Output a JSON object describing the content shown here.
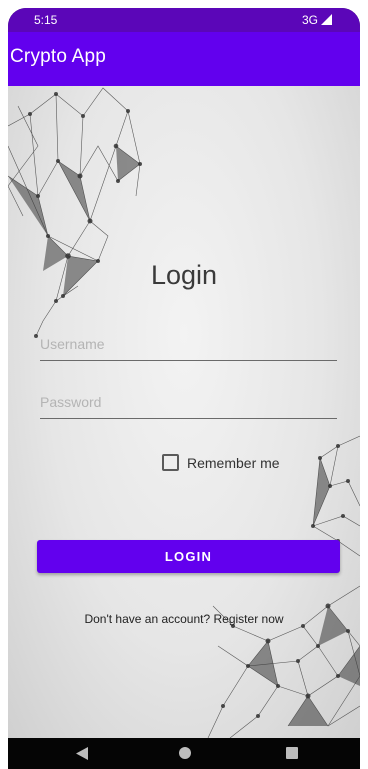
{
  "status_bar": {
    "time": "5:15",
    "network": "3G",
    "signal_icon": "signal-icon"
  },
  "app_bar": {
    "title": "Crypto App"
  },
  "login": {
    "title": "Login",
    "username_placeholder": "Username",
    "password_placeholder": "Password",
    "remember_label": "Remember me",
    "remember_checked": false,
    "button_label": "LOGIN",
    "register_text": "Don't have an account? Register now"
  },
  "nav_bar": {
    "back_icon": "back-triangle-icon",
    "home_icon": "home-circle-icon",
    "recents_icon": "recents-square-icon"
  },
  "colors": {
    "primary": "#6200ee",
    "primary_dark": "#5b06b8",
    "background": "#e6e6e6",
    "nav_bar": "#050505"
  }
}
